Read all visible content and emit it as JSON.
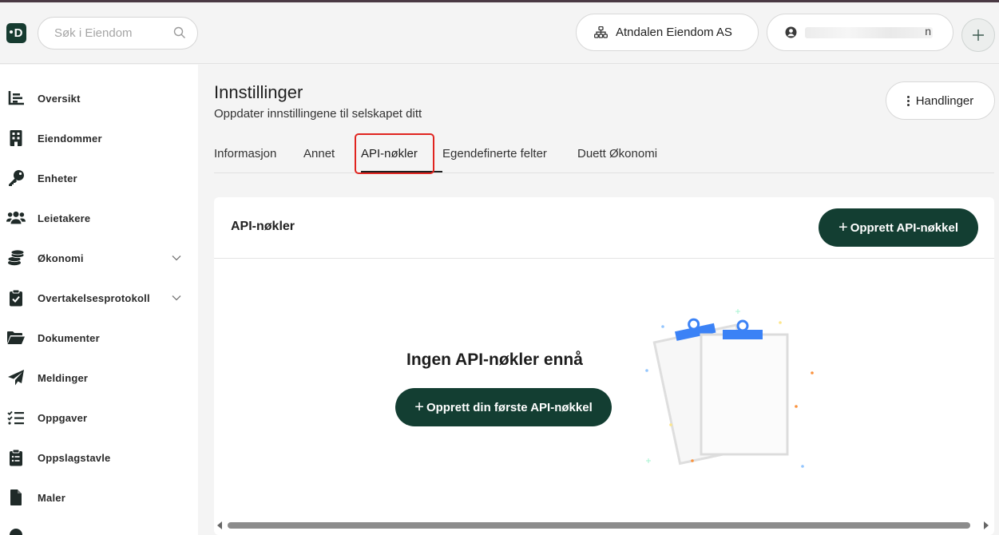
{
  "header": {
    "logo_letter": "D",
    "search_placeholder": "Søk i Eiendom",
    "company_name": "Atndalen Eiendom AS",
    "user_name_tail": "n"
  },
  "sidebar": {
    "items": [
      {
        "label": "Oversikt",
        "icon": "chart-bars-icon"
      },
      {
        "label": "Eiendommer",
        "icon": "building-icon"
      },
      {
        "label": "Enheter",
        "icon": "key-icon"
      },
      {
        "label": "Leietakere",
        "icon": "users-icon"
      },
      {
        "label": "Økonomi",
        "icon": "coins-icon",
        "expandable": true
      },
      {
        "label": "Overtakelsesprotokoll",
        "icon": "clipboard-check-icon",
        "expandable": true
      },
      {
        "label": "Dokumenter",
        "icon": "folder-icon"
      },
      {
        "label": "Meldinger",
        "icon": "paper-plane-icon"
      },
      {
        "label": "Oppgaver",
        "icon": "task-list-icon"
      },
      {
        "label": "Oppslagstavle",
        "icon": "clipboard-list-icon"
      },
      {
        "label": "Maler",
        "icon": "document-icon"
      }
    ]
  },
  "main": {
    "title": "Innstillinger",
    "subtitle": "Oppdater innstillingene til selskapet ditt",
    "actions_label": "Handlinger",
    "tabs": [
      {
        "label": "Informasjon",
        "active": false
      },
      {
        "label": "Annet",
        "active": false
      },
      {
        "label": "API-nøkler",
        "active": true
      },
      {
        "label": "Egendefinerte felter",
        "active": false
      },
      {
        "label": "Duett Økonomi",
        "active": false
      }
    ]
  },
  "card": {
    "title": "API-nøkler",
    "create_button": "Opprett API-nøkkel",
    "empty_title": "Ingen API-nøkler ennå",
    "first_button": "Opprett din første API-nøkkel"
  },
  "colors": {
    "primary": "#133e32",
    "highlight": "#e0241f",
    "illustration_clip": "#3b82f6"
  }
}
